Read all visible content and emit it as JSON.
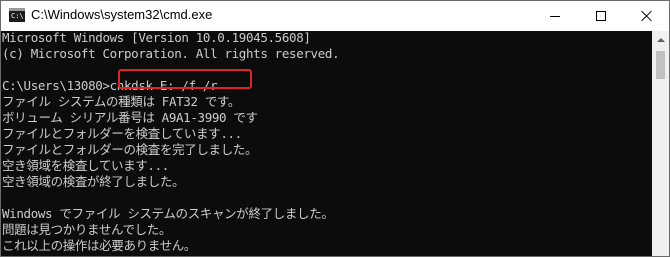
{
  "window": {
    "title": "C:\\Windows\\system32\\cmd.exe",
    "icon_name": "cmd-console-icon",
    "icon_prompt": "C:\\"
  },
  "console": {
    "background": "#0c0c0c",
    "text_color": "#cccccc",
    "highlight_color": "#e02424",
    "lines": [
      "Microsoft Windows [Version 10.0.19045.5608]",
      "(c) Microsoft Corporation. All rights reserved.",
      "",
      "C:\\Users\\13080>chkdsk E: /f /r",
      "ファイル システムの種類は FAT32 です。",
      "ボリューム シリアル番号は A9A1-3990 です",
      "ファイルとフォルダーを検査しています...",
      "ファイルとフォルダーの検査を完了しました。",
      "空き領域を検査しています...",
      "空き領域の検査が終了しました。",
      "",
      "Windows でファイル システムのスキャンが終了しました。",
      "問題は見つかりませんでした。",
      "これ以上の操作は必要ありません。"
    ]
  }
}
